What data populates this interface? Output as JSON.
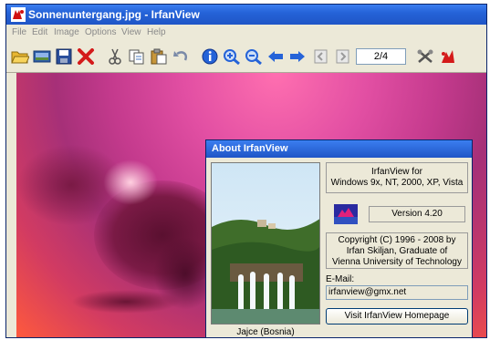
{
  "window": {
    "title": "Sonnenuntergang.jpg - IrfanView",
    "icon": "irfanview-red-cat-icon"
  },
  "menu": [
    "File",
    "Edit",
    "Image",
    "Options",
    "View",
    "Help"
  ],
  "toolbar": {
    "icons": [
      "open-folder-icon",
      "slideshow-icon",
      "save-icon",
      "delete-icon",
      "cut-icon",
      "copy-icon",
      "paste-icon",
      "undo-icon",
      "info-icon",
      "zoom-in-icon",
      "zoom-out-icon",
      "previous-arrow-icon",
      "next-arrow-icon",
      "first-page-icon",
      "last-page-icon",
      "settings-icon",
      "paint-icon"
    ],
    "page_indicator": "2/4"
  },
  "about": {
    "title": "About  IrfanView",
    "product": "IrfanView for",
    "platforms": "Windows 9x, NT, 2000, XP, Vista",
    "version": "Version 4.20",
    "copyright_1": "Copyright (C) 1996 - 2008 by",
    "copyright_2": "Irfan Skiljan, Graduate of",
    "copyright_3": "Vienna University of Technology",
    "email_label": "E-Mail:",
    "email": "irfanview@gmx.net",
    "homepage_button": "Visit IrfanView Homepage",
    "photo_caption": "Jajce (Bosnia)"
  },
  "colors": {
    "titlebar": "#2563d8",
    "dialog_bg": "#ece9d8",
    "sky_pink": "#e24fa3",
    "sky_orange": "#ff5a3c"
  }
}
